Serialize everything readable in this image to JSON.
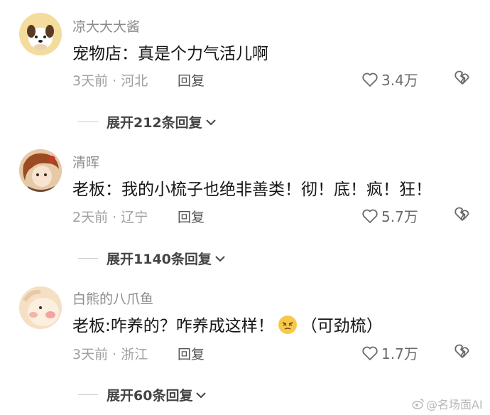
{
  "comments": [
    {
      "username": "凉大大大酱",
      "text": "宠物店：真是个力气活儿啊",
      "meta": "3天前 · 河北",
      "reply_label": "回复",
      "likes": "3.4万",
      "expand": "展开212条回复"
    },
    {
      "username": "清晖",
      "text": "老板：我的小梳子也绝非善类！彻！底！疯！狂！",
      "meta": "2天前 · 辽宁",
      "reply_label": "回复",
      "likes": "5.7万",
      "expand": "展开1140条回复"
    },
    {
      "username": "白熊的八爪鱼",
      "text_before": "老板:咋养的？咋养成这样！",
      "text_after": "（可劲梳）",
      "meta": "3天前 · 浙江",
      "reply_label": "回复",
      "likes": "1.7万",
      "expand": "展开60条回复"
    }
  ],
  "watermark": "@名场面AI",
  "icons": {
    "like": "heart-outline-icon",
    "dislike": "broken-heart-icon",
    "expand": "chevron-down-icon",
    "emoji": "squinting-face-emoji",
    "watermark": "weibo-logo-icon"
  }
}
